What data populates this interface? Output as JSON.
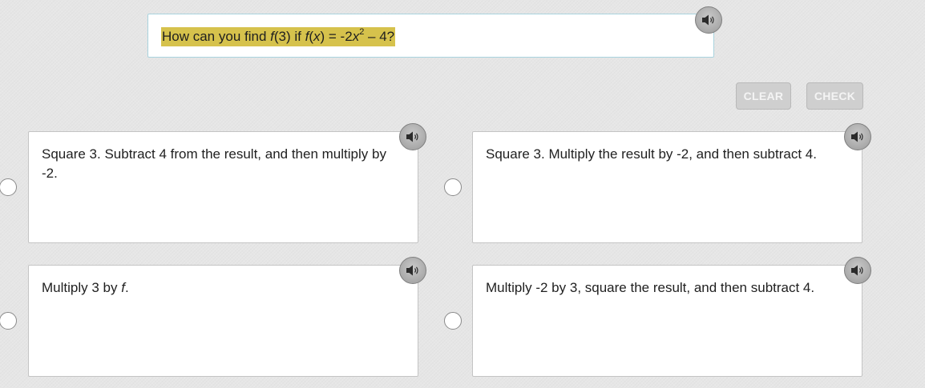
{
  "question": {
    "prefix": "How can you find ",
    "fn_a": "f",
    "arg_a": "(3) if ",
    "fn_b": "f",
    "paren_open": "(",
    "var": "x",
    "paren_close": ")",
    "eq": " = -2",
    "var2": "x",
    "exponent": "2",
    "suffix": " – 4?",
    "highlight_color": "#d6c24c"
  },
  "toolbar": {
    "clear_label": "CLEAR",
    "check_label": "CHECK"
  },
  "answers": [
    {
      "text": "Square 3. Subtract 4 from the result, and then multiply by -2."
    },
    {
      "text": "Square 3. Multiply the result by -2, and then subtract 4."
    },
    {
      "text_before": "Multiply 3 by ",
      "text_italic": "f",
      "text_after": "."
    },
    {
      "text": "Multiply -2 by 3, square the result, and then subtract 4."
    }
  ],
  "icons": {
    "speaker": "speaker-icon",
    "radio": "radio-button"
  }
}
